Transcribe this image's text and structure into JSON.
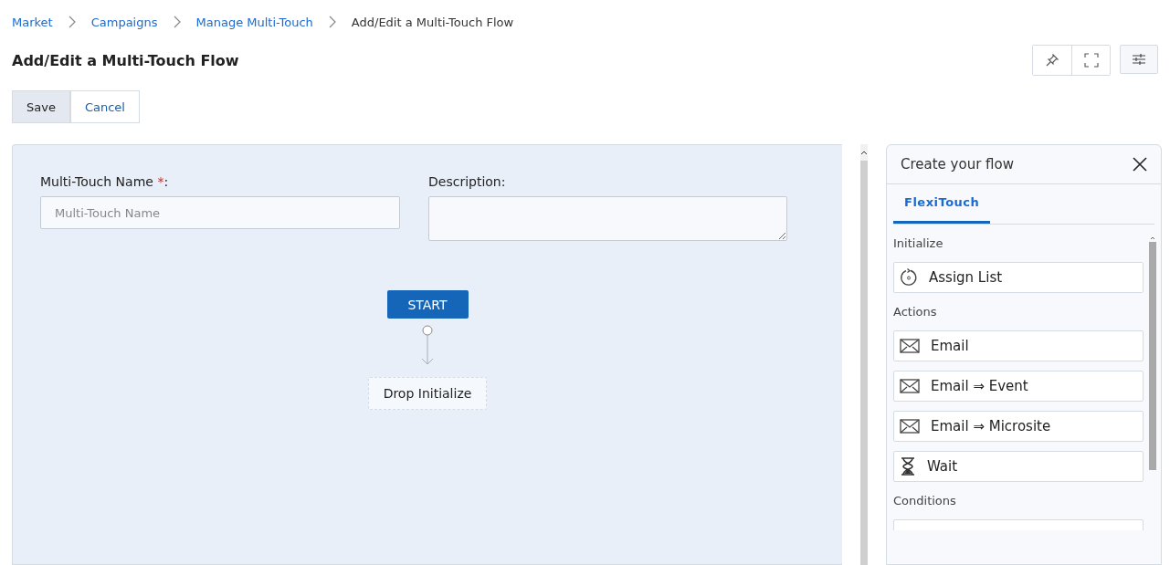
{
  "breadcrumb": [
    {
      "label": "Market",
      "link": true
    },
    {
      "label": "Campaigns",
      "link": true
    },
    {
      "label": "Manage Multi-Touch",
      "link": true
    },
    {
      "label": "Add/Edit a Multi-Touch Flow",
      "link": false
    }
  ],
  "title": "Add/Edit a Multi-Touch Flow",
  "buttons": [
    {
      "label": "Save",
      "kind": "primary"
    },
    {
      "label": "Cancel",
      "kind": "secondary"
    }
  ],
  "form": {
    "name_label": "Multi-Touch Name",
    "required_mark": "*",
    "name_suffix": ":",
    "name_placeholder": "Multi-Touch Name",
    "description_label": "Description:"
  },
  "flow": {
    "start": "START",
    "drop": "Drop Initialize"
  },
  "panel": {
    "title": "Create your flow",
    "tabs": [
      {
        "label": "FlexiTouch",
        "selected": true
      }
    ],
    "sections": [
      {
        "heading": "Initialize",
        "items": [
          {
            "label": "Assign List",
            "kind": "cycle"
          }
        ]
      },
      {
        "heading": "Actions",
        "items": [
          {
            "label": "Email",
            "kind": "mail"
          },
          {
            "label": "Email ⇒ Event",
            "kind": "mail"
          },
          {
            "label": "Email ⇒ Microsite",
            "kind": "mail"
          },
          {
            "label": "Wait",
            "kind": "hourglass"
          }
        ]
      },
      {
        "heading": "Conditions",
        "items": [
          {
            "kind": "condition"
          }
        ]
      }
    ]
  }
}
